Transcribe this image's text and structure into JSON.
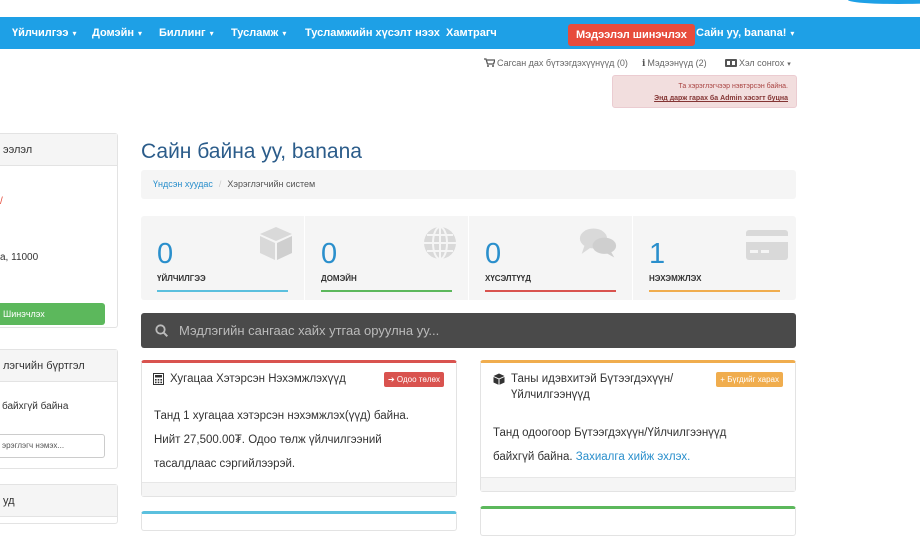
{
  "nav": {
    "items": [
      {
        "label": "Үйлчилгээ",
        "caret": true
      },
      {
        "label": "Домэйн",
        "caret": true
      },
      {
        "label": "Биллинг",
        "caret": true
      },
      {
        "label": "Тусламж",
        "caret": true
      },
      {
        "label": "Тусламжийн хүсэлт нээх",
        "caret": false
      },
      {
        "label": "Хамтрагч",
        "caret": false
      }
    ],
    "update_info_button": "Мэдээлэл шинэчлэх",
    "user_greeting": "Сайн уу, banana!",
    "caret_glyph": "▾"
  },
  "utility": {
    "cart": "Сагсан дах бүтээгдэхүүнүүд (0)",
    "notifications": "Мэдээнүүд (2)",
    "language": "Хэл сонгох"
  },
  "admin_alert": {
    "line1": "Та хэрэглэгчээр нэвтэрсэн байна.",
    "link": "Энд дарж гарах ба Admin хэсэгт буцна"
  },
  "sidebar": {
    "panel1_title": "ээлэл",
    "panel1_text1": "/",
    "panel1_text2": "а, 11000",
    "update_button": "Шинэчлэх",
    "panel2_title": "лэгчийн бүртгэл",
    "panel2_text": "байхгүй байна",
    "panel2_input": "эрэглэгч нэмэх...",
    "panel3_title": "уд"
  },
  "page": {
    "title": "Сайн байна уу, banana",
    "breadcrumb_home": "Үндсэн хуудас",
    "breadcrumb_sep": "/",
    "breadcrumb_current": "Хэрэглэгчийн систем"
  },
  "tiles": [
    {
      "value": "0",
      "label": "ҮЙЛЧИЛГЭЭ",
      "color": "#5bc0de",
      "icon": "cube-icon"
    },
    {
      "value": "0",
      "label": "ДОМЭЙН",
      "color": "#5cb85c",
      "icon": "globe-icon"
    },
    {
      "value": "0",
      "label": "ХҮСЭЛТҮҮД",
      "color": "#d9534f",
      "icon": "comments-icon"
    },
    {
      "value": "1",
      "label": "НЭХЭМЖЛЭХ",
      "color": "#f0ad4e",
      "icon": "credit-card-icon"
    }
  ],
  "search": {
    "placeholder": "Мэдлэгийн сангаас хайх утгаа оруулна уу..."
  },
  "cards": {
    "overdue": {
      "title": "Хугацаа Хэтэрсэн Нэхэмжлэхүүд",
      "badge": "Одоо төлөх",
      "line1": "Танд 1 хугацаа хэтэрсэн нэхэмжлэх(үүд) байна.",
      "line2": "Нийт 27,500.00₮. Одоо төлж үйлчилгээний",
      "line3": "тасалдлаас сэргийлээрэй.",
      "accent": "#d9534f"
    },
    "products": {
      "title_line1": "Таны идэвхитэй Бүтээгдэхүүн/",
      "title_line2": "Үйлчилгээнүүд",
      "badge": "Бүгдийг харах",
      "line1": "Танд одоогоор Бүтээгдэхүүн/Үйлчилгээнүүд",
      "line2_text": "байхгүй байна.",
      "line2_link": "Захиалга хийж эхлэх.",
      "accent": "#f0ad4e"
    }
  }
}
